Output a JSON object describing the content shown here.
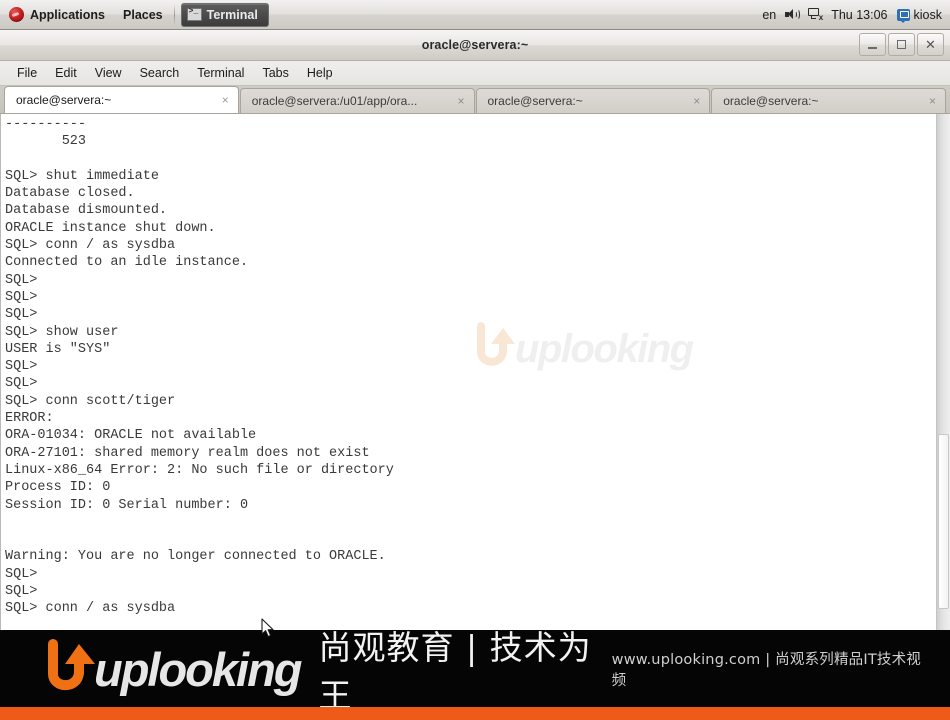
{
  "top_panel": {
    "applications_label": "Applications",
    "places_label": "Places",
    "task_button_label": "Terminal",
    "task_button_icon": "terminal-icon",
    "fedora_icon": "fedora-logo-icon",
    "keyboard_layout": "en",
    "volume_icon": "speaker-icon",
    "network_icon": "network-disconnected-icon",
    "clock": "Thu 13:06",
    "user_icon": "user-kiosk-icon",
    "user_label": "kiosk"
  },
  "window": {
    "title": "oracle@servera:~",
    "controls": {
      "minimize": "minimize-button",
      "maximize": "maximize-button",
      "close": "close-button"
    },
    "menus": [
      "File",
      "Edit",
      "View",
      "Search",
      "Terminal",
      "Tabs",
      "Help"
    ],
    "tabs": [
      {
        "label": "oracle@servera:~",
        "active": true,
        "close": "×"
      },
      {
        "label": "oracle@servera:/u01/app/ora...",
        "active": false,
        "close": "×"
      },
      {
        "label": "oracle@servera:~",
        "active": false,
        "close": "×"
      },
      {
        "label": "oracle@servera:~",
        "active": false,
        "close": "×"
      }
    ]
  },
  "terminal": {
    "lines": [
      "----------",
      "       523",
      "",
      "SQL> shut immediate",
      "Database closed.",
      "Database dismounted.",
      "ORACLE instance shut down.",
      "SQL> conn / as sysdba",
      "Connected to an idle instance.",
      "SQL>",
      "SQL>",
      "SQL>",
      "SQL> show user",
      "USER is \"SYS\"",
      "SQL>",
      "SQL>",
      "SQL> conn scott/tiger",
      "ERROR:",
      "ORA-01034: ORACLE not available",
      "ORA-27101: shared memory realm does not exist",
      "Linux-x86_64 Error: 2: No such file or directory",
      "Process ID: 0",
      "Session ID: 0 Serial number: 0",
      "",
      "",
      "Warning: You are no longer connected to ORACLE.",
      "SQL>",
      "SQL>",
      "SQL> conn / as sysdba"
    ],
    "watermark_text": "uplooking",
    "watermark_icon": "uplooking-arrow-icon"
  },
  "banner": {
    "logo_icon": "uplooking-arrow-icon",
    "logo_word": "uplooking",
    "tagline_cn": "尚观教育 | 技术为王",
    "right_text": "www.uplooking.com | 尚观系列精品IT技术视频"
  },
  "colors": {
    "brand_orange": "#ee5b18",
    "panel_gray": "#e3e1de",
    "terminal_bg": "#ffffff",
    "terminal_fg": "#3a3a3a",
    "banner_bg": "#050505"
  }
}
